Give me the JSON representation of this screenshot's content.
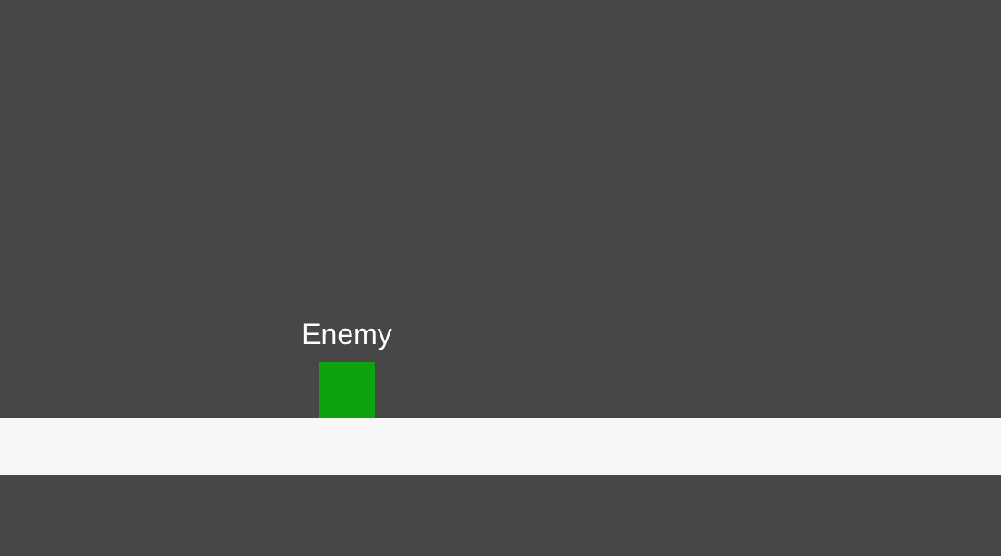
{
  "scene": {
    "background_color": "#474747"
  },
  "enemy": {
    "label": "Enemy",
    "color": "#0ea30e"
  },
  "ground": {
    "color": "#f7f7f7"
  }
}
